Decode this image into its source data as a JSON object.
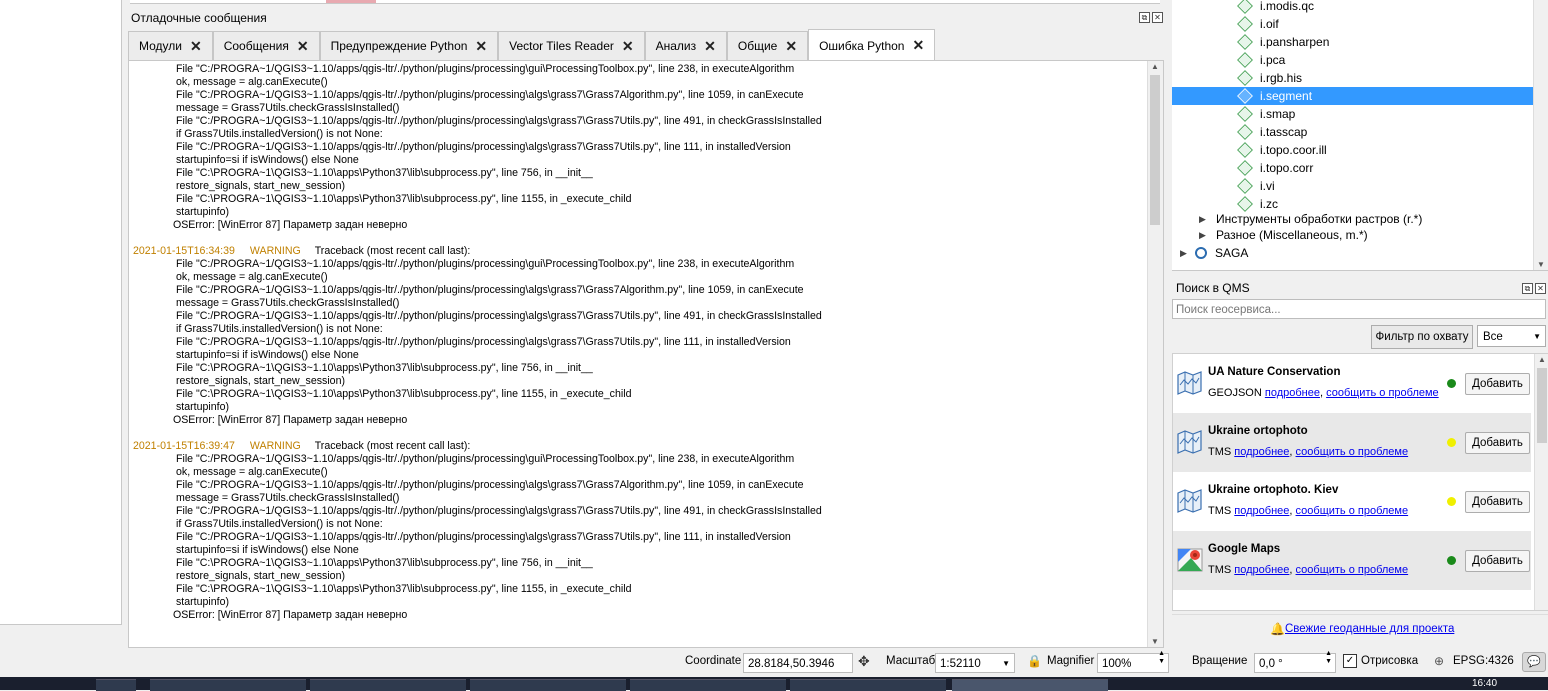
{
  "log_dock": {
    "title": "Отладочные сообщения",
    "tabs": [
      {
        "label": "Модули"
      },
      {
        "label": "Сообщения"
      },
      {
        "label": "Предупреждение Python"
      },
      {
        "label": "Vector Tiles Reader"
      },
      {
        "label": "Анализ"
      },
      {
        "label": "Общие"
      },
      {
        "label": "Ошибка Python"
      }
    ],
    "active_tab": "Ошибка Python",
    "lines": [
      {
        "indent": true,
        "text": "File \"C:/PROGRA~1/QGIS3~1.10/apps/qgis-ltr/./python/plugins/processing\\gui\\ProcessingToolbox.py\", line 238, in executeAlgorithm"
      },
      {
        "indent": true,
        "text": "ok, message = alg.canExecute()"
      },
      {
        "indent": true,
        "text": "File \"C:/PROGRA~1/QGIS3~1.10/apps/qgis-ltr/./python/plugins/processing\\algs\\grass7\\Grass7Algorithm.py\", line 1059, in canExecute"
      },
      {
        "indent": true,
        "text": "message = Grass7Utils.checkGrassIsInstalled()"
      },
      {
        "indent": true,
        "text": "File \"C:/PROGRA~1/QGIS3~1.10/apps/qgis-ltr/./python/plugins/processing\\algs\\grass7\\Grass7Utils.py\", line 491, in checkGrassIsInstalled"
      },
      {
        "indent": true,
        "text": "if Grass7Utils.installedVersion() is not None:"
      },
      {
        "indent": true,
        "text": "File \"C:/PROGRA~1/QGIS3~1.10/apps/qgis-ltr/./python/plugins/processing\\algs\\grass7\\Grass7Utils.py\", line 111, in installedVersion"
      },
      {
        "indent": true,
        "text": "startupinfo=si if isWindows() else None"
      },
      {
        "indent": true,
        "text": "File \"C:\\PROGRA~1\\QGIS3~1.10\\apps\\Python37\\lib\\subprocess.py\", line 756, in __init__"
      },
      {
        "indent": true,
        "text": "restore_signals, start_new_session)"
      },
      {
        "indent": true,
        "text": "File \"C:\\PROGRA~1\\QGIS3~1.10\\apps\\Python37\\lib\\subprocess.py\", line 1155, in _execute_child"
      },
      {
        "indent": true,
        "text": "startupinfo)"
      },
      {
        "indent": "os",
        "text": "OSError: [WinError 87] Параметр задан неверно"
      },
      {
        "blank": true,
        "text": ""
      },
      {
        "header": true,
        "ts": "2021-01-15T16:34:39",
        "level": "WARNING",
        "text": "Traceback (most recent call last):"
      },
      {
        "indent": true,
        "text": "File \"C:/PROGRA~1/QGIS3~1.10/apps/qgis-ltr/./python/plugins/processing\\gui\\ProcessingToolbox.py\", line 238, in executeAlgorithm"
      },
      {
        "indent": true,
        "text": "ok, message = alg.canExecute()"
      },
      {
        "indent": true,
        "text": "File \"C:/PROGRA~1/QGIS3~1.10/apps/qgis-ltr/./python/plugins/processing\\algs\\grass7\\Grass7Algorithm.py\", line 1059, in canExecute"
      },
      {
        "indent": true,
        "text": "message = Grass7Utils.checkGrassIsInstalled()"
      },
      {
        "indent": true,
        "text": "File \"C:/PROGRA~1/QGIS3~1.10/apps/qgis-ltr/./python/plugins/processing\\algs\\grass7\\Grass7Utils.py\", line 491, in checkGrassIsInstalled"
      },
      {
        "indent": true,
        "text": "if Grass7Utils.installedVersion() is not None:"
      },
      {
        "indent": true,
        "text": "File \"C:/PROGRA~1/QGIS3~1.10/apps/qgis-ltr/./python/plugins/processing\\algs\\grass7\\Grass7Utils.py\", line 111, in installedVersion"
      },
      {
        "indent": true,
        "text": "startupinfo=si if isWindows() else None"
      },
      {
        "indent": true,
        "text": "File \"C:\\PROGRA~1\\QGIS3~1.10\\apps\\Python37\\lib\\subprocess.py\", line 756, in __init__"
      },
      {
        "indent": true,
        "text": "restore_signals, start_new_session)"
      },
      {
        "indent": true,
        "text": "File \"C:\\PROGRA~1\\QGIS3~1.10\\apps\\Python37\\lib\\subprocess.py\", line 1155, in _execute_child"
      },
      {
        "indent": true,
        "text": "startupinfo)"
      },
      {
        "indent": "os",
        "text": "OSError: [WinError 87] Параметр задан неверно"
      },
      {
        "blank": true,
        "text": ""
      },
      {
        "header": true,
        "ts": "2021-01-15T16:39:47",
        "level": "WARNING",
        "text": "Traceback (most recent call last):"
      },
      {
        "indent": true,
        "text": "File \"C:/PROGRA~1/QGIS3~1.10/apps/qgis-ltr/./python/plugins/processing\\gui\\ProcessingToolbox.py\", line 238, in executeAlgorithm"
      },
      {
        "indent": true,
        "text": "ok, message = alg.canExecute()"
      },
      {
        "indent": true,
        "text": "File \"C:/PROGRA~1/QGIS3~1.10/apps/qgis-ltr/./python/plugins/processing\\algs\\grass7\\Grass7Algorithm.py\", line 1059, in canExecute"
      },
      {
        "indent": true,
        "text": "message = Grass7Utils.checkGrassIsInstalled()"
      },
      {
        "indent": true,
        "text": "File \"C:/PROGRA~1/QGIS3~1.10/apps/qgis-ltr/./python/plugins/processing\\algs\\grass7\\Grass7Utils.py\", line 491, in checkGrassIsInstalled"
      },
      {
        "indent": true,
        "text": "if Grass7Utils.installedVersion() is not None:"
      },
      {
        "indent": true,
        "text": "File \"C:/PROGRA~1/QGIS3~1.10/apps/qgis-ltr/./python/plugins/processing\\algs\\grass7\\Grass7Utils.py\", line 111, in installedVersion"
      },
      {
        "indent": true,
        "text": "startupinfo=si if isWindows() else None"
      },
      {
        "indent": true,
        "text": "File \"C:\\PROGRA~1\\QGIS3~1.10\\apps\\Python37\\lib\\subprocess.py\", line 756, in __init__"
      },
      {
        "indent": true,
        "text": "restore_signals, start_new_session)"
      },
      {
        "indent": true,
        "text": "File \"C:\\PROGRA~1\\QGIS3~1.10\\apps\\Python37\\lib\\subprocess.py\", line 1155, in _execute_child"
      },
      {
        "indent": true,
        "text": "startupinfo)"
      },
      {
        "indent": "os",
        "text": "OSError: [WinError 87] Параметр задан неверно"
      }
    ],
    "colors": {
      "timestamp": "#c08000"
    }
  },
  "processing_tree": {
    "leaves": [
      "i.modis.qc",
      "i.oif",
      "i.pansharpen",
      "i.pca",
      "i.rgb.his",
      "i.segment",
      "i.smap",
      "i.tasscap",
      "i.topo.coor.ill",
      "i.topo.corr",
      "i.vi",
      "i.zc"
    ],
    "selected": "i.segment",
    "groups": [
      "Инструменты обработки растров (r.*)",
      "Разное (Miscellaneous, m.*)"
    ],
    "provider": "SAGA",
    "selection_color": "#3399ff"
  },
  "qms": {
    "title": "Поиск в QMS",
    "search_placeholder": "Поиск геосервиса...",
    "filter_button": "Фильтр по охвату",
    "filter_value": "Все",
    "services": [
      {
        "name": "UA Nature Conservation",
        "type": "GEOJSON",
        "status_color": "#1a8a1a",
        "icon": "map-icon"
      },
      {
        "name": "Ukraine ortophoto",
        "type": "TMS",
        "status_color": "#f0f000",
        "icon": "map-icon"
      },
      {
        "name": "Ukraine ortophoto. Kiev",
        "type": "TMS",
        "status_color": "#f0f000",
        "icon": "map-icon"
      },
      {
        "name": "Google Maps",
        "type": "TMS",
        "status_color": "#1a8a1a",
        "icon": "google-maps-icon"
      }
    ],
    "details_link": "подробнее",
    "report_link": "сообщить о проблеме",
    "add_button": "Добавить",
    "footer_link": "Свежие геоданные для проекта"
  },
  "status_bar": {
    "coordinate_label": "Coordinate",
    "coordinate_value": "28.8184,50.3946",
    "scale_label": "Масштаб",
    "scale_value": "1:52110",
    "magnifier_label": "Magnifier",
    "magnifier_value": "100%",
    "rotation_label": "Вращение",
    "rotation_value": "0,0 °",
    "render_label": "Отрисовка",
    "render_checked": true,
    "crs": "EPSG:4326"
  },
  "taskbar": {
    "clock": "16:40"
  }
}
